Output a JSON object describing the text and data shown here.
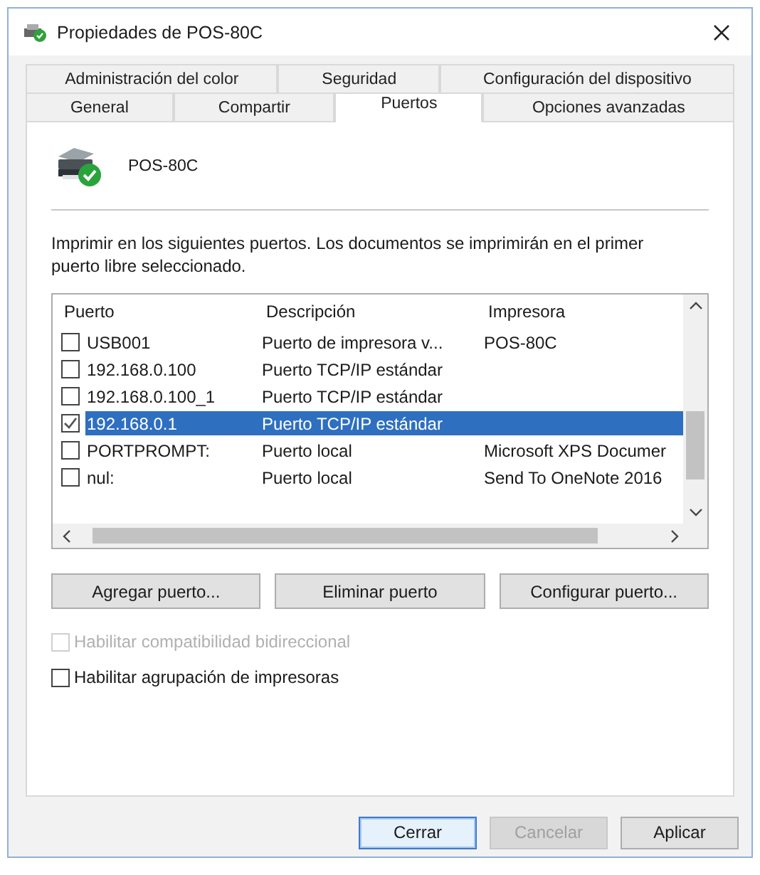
{
  "window": {
    "title": "Propiedades de POS-80C"
  },
  "tab_rows": [
    {
      "tabs": [
        {
          "label": "Administración del color",
          "selected": false
        },
        {
          "label": "Seguridad",
          "selected": false
        },
        {
          "label": "Configuración del dispositivo",
          "selected": false
        }
      ]
    },
    {
      "tabs": [
        {
          "label": "General",
          "selected": false
        },
        {
          "label": "Compartir",
          "selected": false
        },
        {
          "label": "Puertos",
          "selected": true
        },
        {
          "label": "Opciones avanzadas",
          "selected": false
        }
      ]
    }
  ],
  "printer": {
    "name": "POS-80C"
  },
  "instructions": "Imprimir en los siguientes puertos. Los documentos se imprimirán en el primer puerto libre seleccionado.",
  "port_list": {
    "columns": [
      "Puerto",
      "Descripción",
      "Impresora"
    ],
    "rows": [
      {
        "port": "USB001",
        "description": "Puerto de impresora v...",
        "printer": "POS-80C",
        "checked": false,
        "selected": false
      },
      {
        "port": "192.168.0.100",
        "description": "Puerto TCP/IP estándar",
        "checked": false,
        "selected": false
      },
      {
        "port": "192.168.0.100_1",
        "description": "Puerto TCP/IP estándar",
        "checked": false,
        "selected": false
      },
      {
        "port": "192.168.0.1",
        "description": "Puerto TCP/IP estándar",
        "checked": true,
        "selected": true
      },
      {
        "port": "PORTPROMPT:",
        "description": "Puerto local",
        "printer": "Microsoft XPS Documer",
        "checked": false,
        "selected": false
      },
      {
        "port": "nul:",
        "description": "Puerto local",
        "printer": "Send To OneNote 2016",
        "checked": false,
        "selected": false
      }
    ]
  },
  "port_buttons": [
    "Agregar puerto...",
    "Eliminar puerto",
    "Configurar puerto..."
  ],
  "options": [
    {
      "label": "Habilitar compatibilidad bidireccional",
      "checked": false,
      "disabled": true
    },
    {
      "label": "Habilitar agrupación de impresoras",
      "checked": false,
      "disabled": false
    }
  ],
  "buttons": [
    {
      "label": "Cerrar",
      "kind": "default"
    },
    {
      "label": "Cancelar",
      "kind": "disabled"
    },
    {
      "label": "Aplicar",
      "kind": "normal"
    }
  ]
}
